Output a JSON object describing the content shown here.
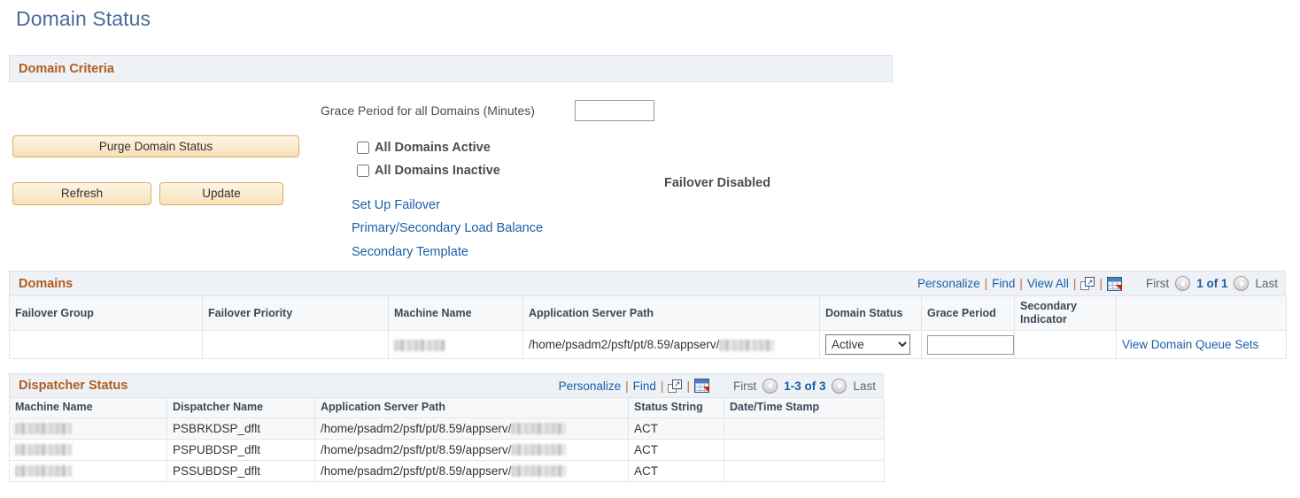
{
  "page": {
    "title": "Domain Status"
  },
  "criteria": {
    "section_title": "Domain Criteria",
    "grace_label": "Grace Period for all Domains (Minutes)",
    "grace_value": "",
    "grace_placeholder": "",
    "buttons": {
      "purge": "Purge Domain Status",
      "refresh": "Refresh",
      "update": "Update"
    },
    "checkboxes": [
      {
        "label": "All Domains Active",
        "checked": false
      },
      {
        "label": "All Domains Inactive",
        "checked": false
      }
    ],
    "failover_state": "Failover Disabled",
    "links": [
      {
        "label": "Set Up Failover"
      },
      {
        "label": "Primary/Secondary Load Balance"
      },
      {
        "label": "Secondary Template"
      }
    ]
  },
  "domains_grid": {
    "title": "Domains",
    "nav": {
      "personalize": "Personalize",
      "find": "Find",
      "view_all": "View All",
      "sep": "|",
      "expand_icon": "expand-window-icon",
      "download_icon": "grid-download-icon"
    },
    "pager": {
      "first": "First",
      "count": "1 of 1",
      "last": "Last",
      "prev_icon": "previous-page-icon",
      "next_icon": "next-page-icon"
    },
    "columns": [
      "Failover Group",
      "Failover Priority",
      "Machine Name",
      "Application Server Path",
      "Domain Status",
      "Grace Period",
      "Secondary Indicator",
      ""
    ],
    "rows": [
      {
        "failover_group": "",
        "failover_priority": "",
        "machine_name": "",
        "machine_name_redacted": true,
        "app_server_path": "/home/psadm2/psft/pt/8.59/appserv/",
        "app_server_path_redacted": true,
        "domain_status": "Active",
        "domain_status_options": [
          "Active",
          "Inactive"
        ],
        "grace_period": "",
        "secondary_indicator": "",
        "action_link": "View Domain Queue Sets"
      }
    ]
  },
  "dispatcher_grid": {
    "title": "Dispatcher Status",
    "nav": {
      "personalize": "Personalize",
      "find": "Find",
      "sep": "|",
      "expand_icon": "expand-window-icon",
      "download_icon": "grid-download-icon"
    },
    "pager": {
      "first": "First",
      "count": "1-3 of 3",
      "last": "Last",
      "prev_icon": "previous-page-icon",
      "next_icon": "next-page-icon"
    },
    "columns": [
      "Machine Name",
      "Dispatcher Name",
      "Application Server Path",
      "Status String",
      "Date/Time Stamp"
    ],
    "rows": [
      {
        "machine_name": "",
        "machine_name_redacted": true,
        "dispatcher_name": "PSBRKDSP_dflt",
        "app_server_path": "/home/psadm2/psft/pt/8.59/appserv/",
        "app_server_path_redacted": true,
        "status_string": "ACT",
        "date_time_stamp": ""
      },
      {
        "machine_name": "",
        "machine_name_redacted": true,
        "dispatcher_name": "PSPUBDSP_dflt",
        "app_server_path": "/home/psadm2/psft/pt/8.59/appserv/",
        "app_server_path_redacted": true,
        "status_string": "ACT",
        "date_time_stamp": ""
      },
      {
        "machine_name": "",
        "machine_name_redacted": true,
        "dispatcher_name": "PSSUBDSP_dflt",
        "app_server_path": "/home/psadm2/psft/pt/8.59/appserv/",
        "app_server_path_redacted": true,
        "status_string": "ACT",
        "date_time_stamp": ""
      }
    ]
  },
  "colors": {
    "page_title": "#4a6c9b",
    "section_header_text": "#b35c1e",
    "section_header_bg": "#eef1f5",
    "link": "#1a5fa8",
    "button_face": "#fbecd1",
    "button_border": "#d9ac6a",
    "grid_header_bg": "#f7f8f9",
    "grid_border": "#e2e5e9"
  }
}
